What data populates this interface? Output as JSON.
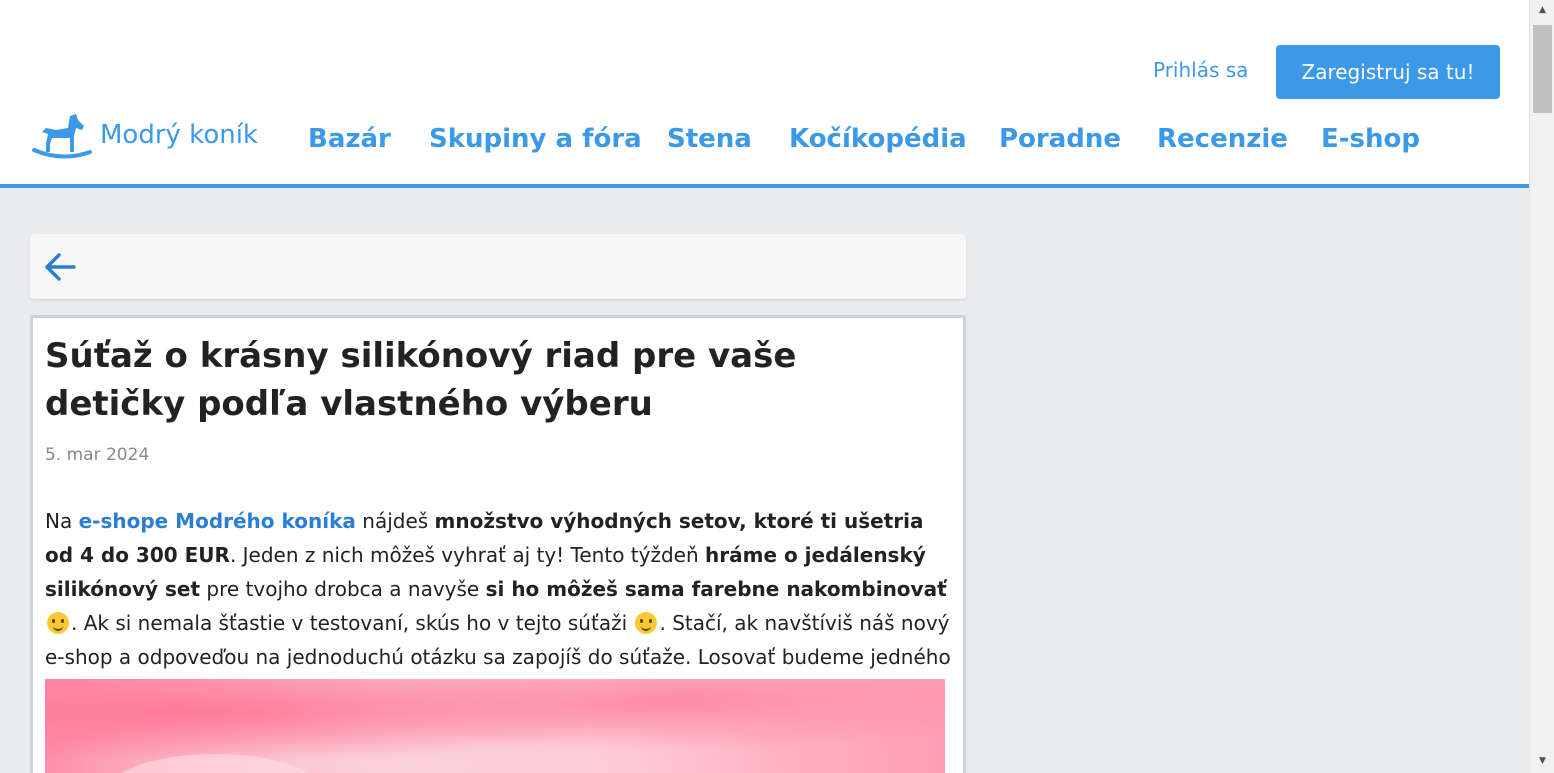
{
  "header": {
    "login_label": "Prihlás sa",
    "register_label": "Zaregistruj sa tu!",
    "logo_text": "Modrý koník",
    "nav": [
      "Bazár",
      "Skupiny a fóra",
      "Stena",
      "Kočíkopédia",
      "Poradne",
      "Recenzie",
      "E-shop"
    ]
  },
  "article": {
    "title": "Súťaž o krásny silikónový riad pre vaše detičky podľa vlastného výberu",
    "date": "5. mar 2024",
    "p1": "Na ",
    "link": "e-shope Modrého koníka",
    "p2": " nájdeš ",
    "b1": "množstvo výhodných setov, ktoré ti ušetria od 4 do 300 EUR",
    "p3": ". Jeden z nich môžeš vyhrať aj ty! Tento týždeň ",
    "b2": "hráme o jedálenský silikónový set",
    "p4": " pre tvojho drobca a navyše ",
    "b3": "si ho môžeš sama farebne nakombinovať",
    "p5": ". Ak si nemala šťastie v testovaní, skús ho v tejto súťaži ",
    "p6": ". Stačí, ak navštíviš náš nový e-shop a odpoveďou na jednoduchú otázku sa zapojíš do súťaže. Losovať budeme jedného výhercu."
  },
  "colors": {
    "accent": "#3b99e8",
    "background": "#e9ebee",
    "link": "#2a7fd4"
  },
  "icons": {
    "back": "arrow-left-icon",
    "logo": "rocking-horse-icon",
    "emoji": "smiling-face-icon"
  }
}
